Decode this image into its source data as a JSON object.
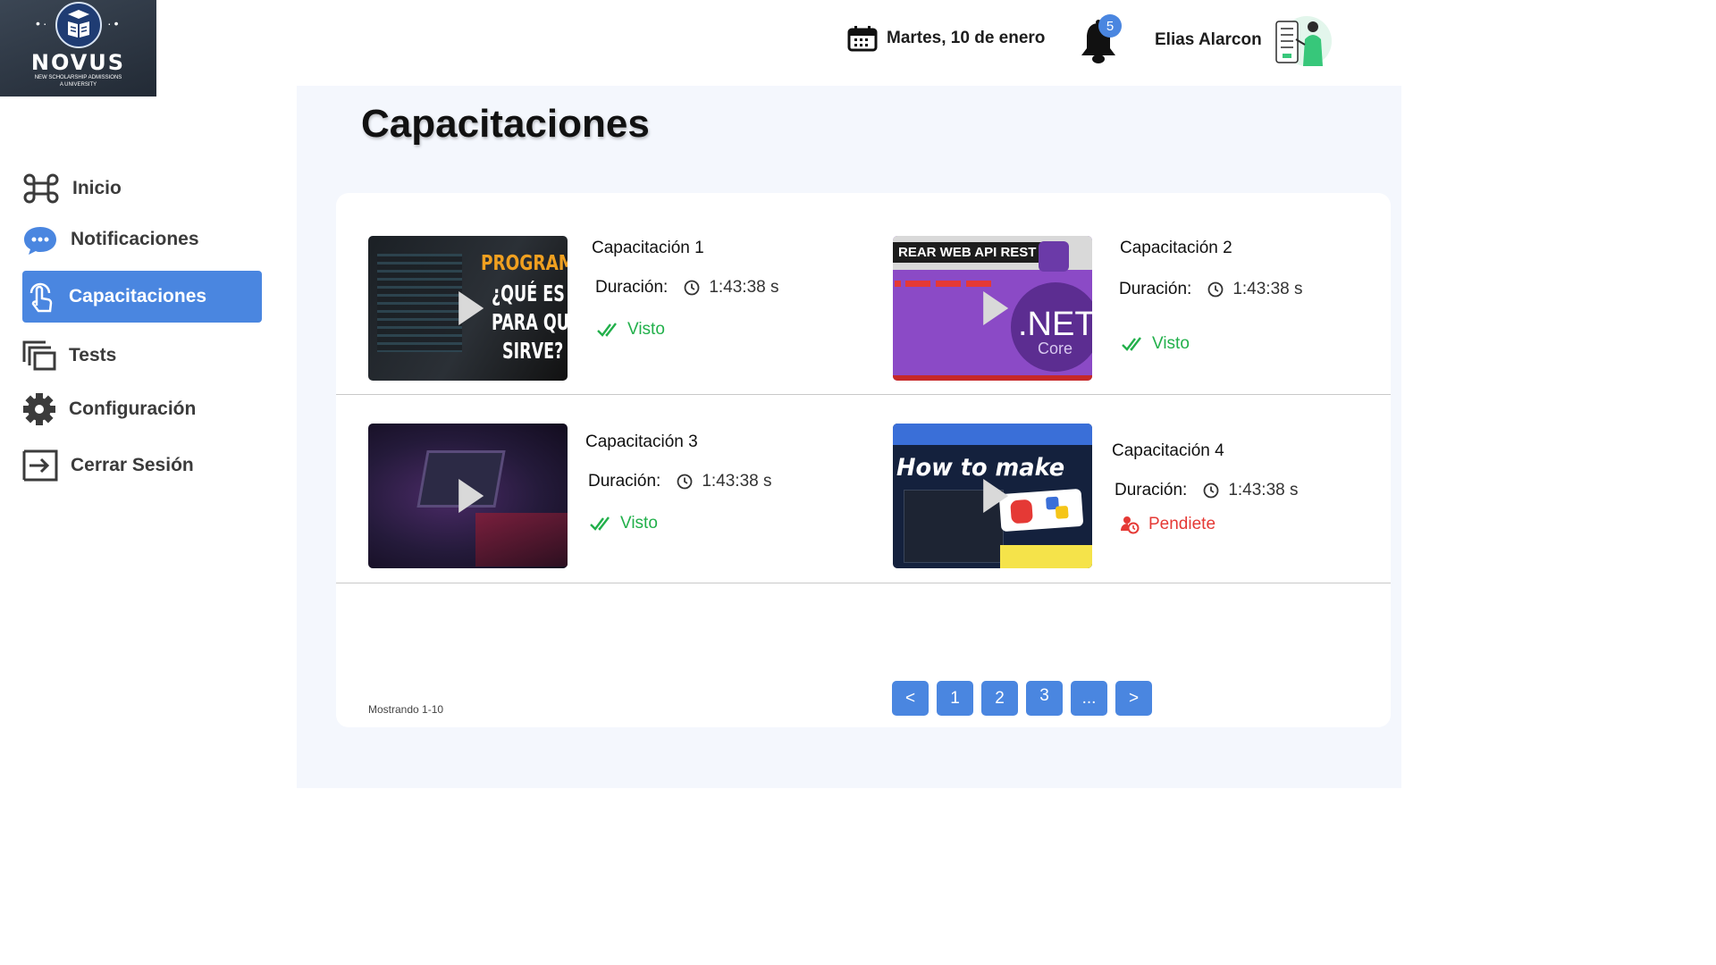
{
  "brand": {
    "name": "NOVUS",
    "subtitle_line1": "NEW SCHOLARSHIP ADMISSIONS",
    "subtitle_line2": "A UNIVERSITY"
  },
  "header": {
    "date": "Martes, 10 de enero",
    "notifications_count": "5",
    "user_name": "Elias Alarcon"
  },
  "sidebar": {
    "items": [
      {
        "label": "Inicio",
        "icon": "command-icon",
        "active": false
      },
      {
        "label": "Notificaciones",
        "icon": "chat-bubble-icon",
        "active": false
      },
      {
        "label": "Capacitaciones",
        "icon": "touch-icon",
        "active": true
      },
      {
        "label": "Tests",
        "icon": "stacked-windows-icon",
        "active": false
      },
      {
        "label": "Configuración",
        "icon": "gear-icon",
        "active": false
      },
      {
        "label": "Cerrar Sesión",
        "icon": "logout-icon",
        "active": false
      }
    ]
  },
  "page": {
    "title": "Capacitaciones"
  },
  "trainings": [
    {
      "title": "Capacitación 1",
      "duration_label": "Duración:",
      "duration": "1:43:38 s",
      "status": "Visto",
      "thumb_text": [
        "PROGRAMA",
        "¿QUÉ ES Y",
        "PARA QUÉ",
        "SIRVE?"
      ]
    },
    {
      "title": "Capacitación 2",
      "duration_label": "Duración:",
      "duration": "1:43:38 s",
      "status": "Visto",
      "thumb_text": [
        "REAR WEB API REST",
        ".NET",
        "Core"
      ]
    },
    {
      "title": "Capacitación 3",
      "duration_label": "Duración:",
      "duration": "1:43:38 s",
      "status": "Visto",
      "thumb_text": []
    },
    {
      "title": "Capacitación 4",
      "duration_label": "Duración:",
      "duration": "1:43:38 s",
      "status": "Pendiete",
      "thumb_text": [
        "How to make"
      ]
    }
  ],
  "pagination": {
    "showing": "Mostrando 1-10",
    "prev": "<",
    "pages": [
      "1",
      "2",
      "3",
      "..."
    ],
    "next": ">"
  },
  "colors": {
    "accent": "#4a86e0",
    "seen": "#22b04b",
    "pending": "#e53935",
    "background": "#f4f7fd"
  }
}
